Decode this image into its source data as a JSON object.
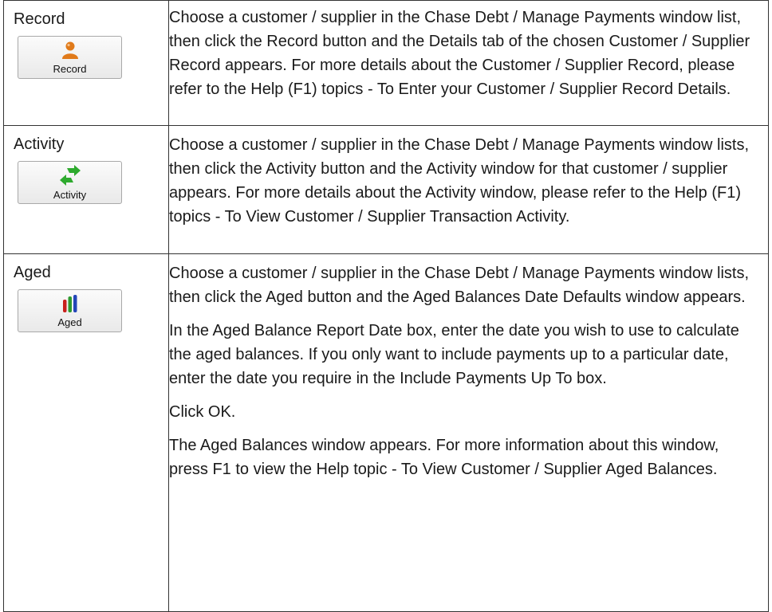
{
  "rows": [
    {
      "command": "Record",
      "button_label": "Record",
      "icon": "person-icon",
      "paragraphs": [
        "Choose a customer / supplier in the Chase Debt / Manage Payments window list, then click the Record button and the Details tab of the chosen Customer / Supplier Record appears. For more details about the Customer / Supplier Record, please refer to the Help (F1) topics - To Enter your Customer / Supplier Record Details."
      ]
    },
    {
      "command": "Activity",
      "button_label": "Activity",
      "icon": "swap-arrows-icon",
      "paragraphs": [
        "Choose a customer / supplier in the Chase Debt / Manage Payments window lists, then click the Activity button and the Activity window for that customer / supplier appears. For more details about the Activity window, please refer to the Help (F1) topics - To View Customer / Supplier Transaction Activity."
      ]
    },
    {
      "command": "Aged",
      "button_label": "Aged",
      "icon": "bar-chart-icon",
      "paragraphs": [
        "Choose a customer / supplier in the Chase Debt / Manage Payments window lists, then click the Aged button and the Aged Balances Date Defaults window appears.",
        "In the Aged Balance Report Date box, enter the date you wish to use to calculate the aged balances. If you only want to include payments up to a particular date, enter the date you require in the Include Payments Up To box.",
        "Click OK.",
        "The Aged Balances window appears. For more information about this window, press F1 to view the Help topic - To View Customer / Supplier Aged Balances."
      ]
    }
  ],
  "colors": {
    "person_orange": "#e07a1a",
    "arrow_green": "#2eaa2e",
    "bar_red": "#c8201c",
    "bar_green": "#2f9a2f",
    "bar_blue": "#2446b8",
    "border": "#333333"
  }
}
